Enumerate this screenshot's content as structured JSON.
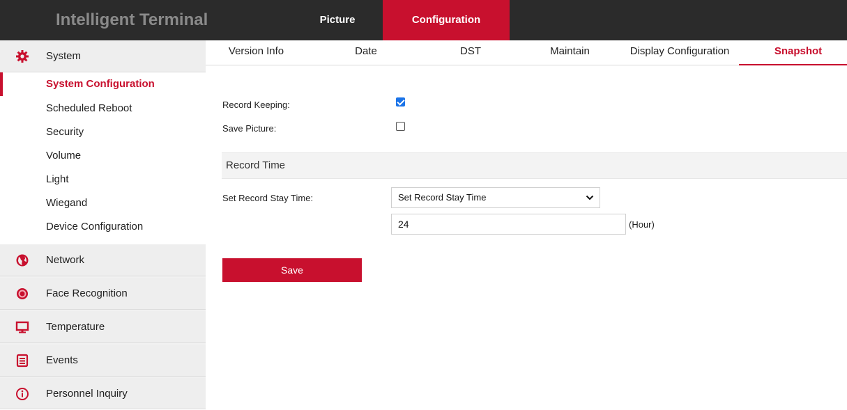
{
  "app": {
    "title": "Intelligent Terminal"
  },
  "topnav": [
    {
      "label": "Picture"
    },
    {
      "label": "Configuration"
    }
  ],
  "colors": {
    "accent": "#c8102e",
    "topbar": "#2b2b2b",
    "checkbox": "#1a73e8"
  },
  "sidebar": {
    "sections": [
      {
        "label": "System",
        "icon": "gear-icon"
      },
      {
        "label": "Network",
        "icon": "globe-icon"
      },
      {
        "label": "Face Recognition",
        "icon": "target-icon"
      },
      {
        "label": "Temperature",
        "icon": "monitor-icon"
      },
      {
        "label": "Events",
        "icon": "list-icon"
      },
      {
        "label": "Personnel Inquiry",
        "icon": "info-icon"
      }
    ],
    "system_items": [
      {
        "label": "System Configuration"
      },
      {
        "label": "Scheduled Reboot"
      },
      {
        "label": "Security"
      },
      {
        "label": "Volume"
      },
      {
        "label": "Light"
      },
      {
        "label": "Wiegand"
      },
      {
        "label": "Device Configuration"
      }
    ]
  },
  "tabs": [
    {
      "label": "Version Info"
    },
    {
      "label": "Date"
    },
    {
      "label": "DST"
    },
    {
      "label": "Maintain"
    },
    {
      "label": "Display Configuration"
    },
    {
      "label": "Snapshot"
    }
  ],
  "form": {
    "record_keeping": {
      "label": "Record Keeping:",
      "checked": true
    },
    "save_picture": {
      "label": "Save Picture:",
      "checked": false
    },
    "record_time_title": "Record Time",
    "stay_time": {
      "label": "Set Record Stay Time:",
      "selected": "Set Record Stay Time",
      "value": "24",
      "unit": "(Hour)"
    },
    "save_label": "Save"
  }
}
